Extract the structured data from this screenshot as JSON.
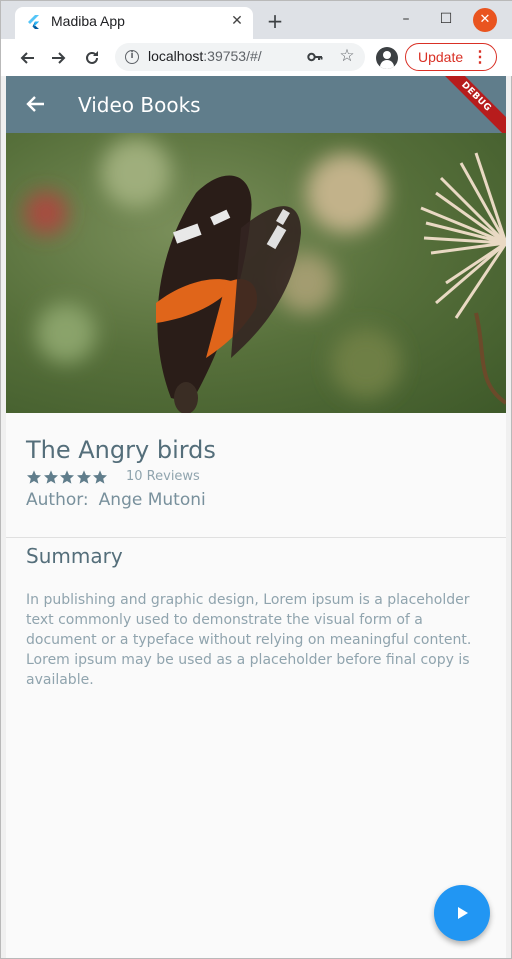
{
  "browser": {
    "tab_title": "Madiba App",
    "tab_close_icon": "close-icon",
    "new_tab_icon": "plus-icon",
    "url_host": "localhost",
    "url_rest": ":39753/#/",
    "update_label": "Update"
  },
  "app": {
    "title": "Video Books",
    "debug_banner": "DEBUG",
    "appbar_color": "#607d8b",
    "accent_color": "#2196f3"
  },
  "book": {
    "title": "The Angry birds",
    "rating": 5,
    "rating_max": 5,
    "reviews": "10 Reviews",
    "author_label": "Author:",
    "author_name": "Ange Mutoni"
  },
  "summary": {
    "heading": "Summary",
    "body": "In publishing and graphic design, Lorem ipsum is a placeholder text commonly used to demonstrate the visual form of a document or a typeface without relying on meaningful content. Lorem ipsum may be used as a placeholder before final copy is available."
  },
  "fab": {
    "icon": "play-icon"
  }
}
